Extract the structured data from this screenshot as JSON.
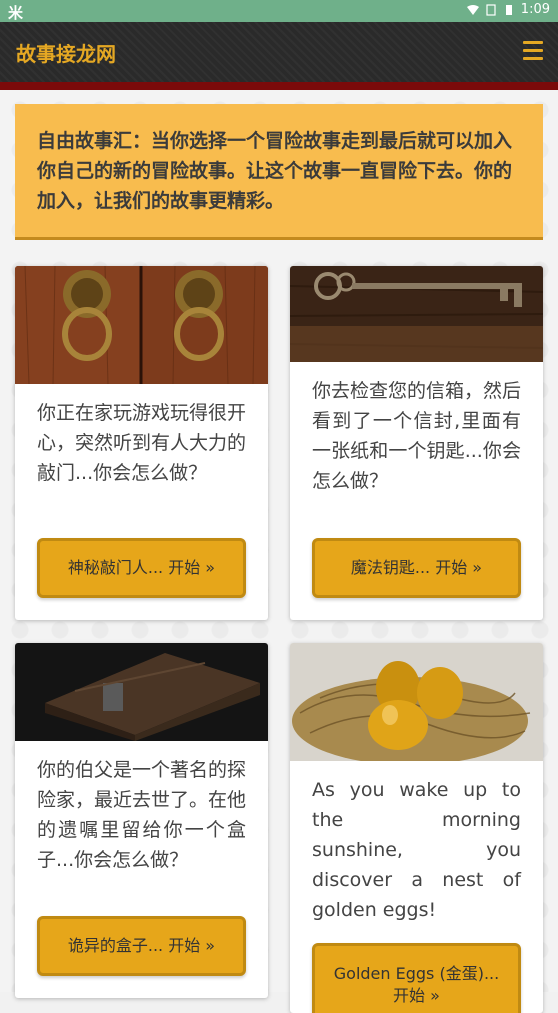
{
  "status_bar": {
    "left_icon": "mi-icon",
    "time": "1:09"
  },
  "navbar": {
    "brand": "故事接龙网",
    "menu_icon": "hamburger-icon"
  },
  "intro": {
    "text": "自由故事汇：当你选择一个冒险故事走到最后就可以加入你自己的新的冒险故事。让这个故事一直冒险下去。你的加入，让我们的故事更精彩。"
  },
  "cards": [
    {
      "text": "你正在家玩游戏玩得很开心，突然听到有人大力的敲门...你会怎么做？",
      "button": "神秘敲门人... 开始 »"
    },
    {
      "text": "你去检查您的信箱，然后看到了一个信封,里面有一张纸和一个钥匙...你会怎么做？",
      "button": "魔法钥匙... 开始 »"
    },
    {
      "text": "你的伯父是一个著名的探险家，最近去世了。在他的遗嘱里留给你一个盒子...你会怎么做？",
      "button": "诡异的盒子... 开始 »"
    },
    {
      "text": "As you wake up to the morning sunshine, you discover a nest of golden eggs!",
      "button": "Golden Eggs (金蛋)... 开始 »"
    }
  ]
}
